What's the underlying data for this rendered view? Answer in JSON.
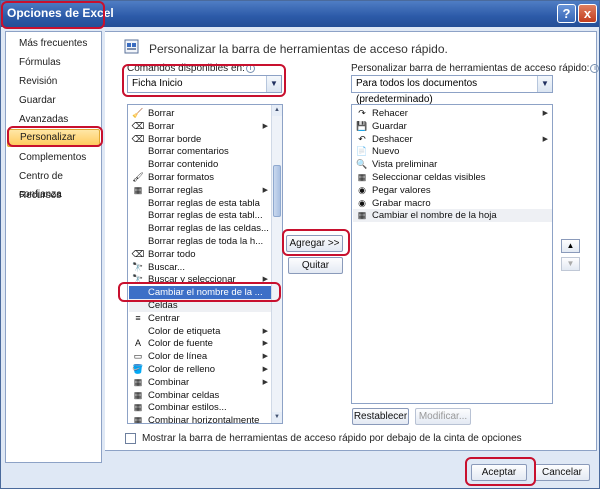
{
  "window": {
    "title": "Opciones de Excel",
    "help_glyph": "?",
    "close_glyph": "x"
  },
  "sidebar": {
    "items": [
      {
        "label": "Más frecuentes"
      },
      {
        "label": "Fórmulas"
      },
      {
        "label": "Revisión"
      },
      {
        "label": "Guardar"
      },
      {
        "label": "Avanzadas"
      },
      {
        "label": "Personalizar",
        "selected": true
      },
      {
        "label": "Complementos"
      },
      {
        "label": "Centro de confianza"
      },
      {
        "label": "Recursos"
      }
    ]
  },
  "header": {
    "title": "Personalizar la barra de herramientas de acceso rápido."
  },
  "commands": {
    "label": "Comandos disponibles en:",
    "combo_value": "Ficha Inicio",
    "items": [
      {
        "label": "Borrar",
        "icon": "🧹"
      },
      {
        "label": "Borrar",
        "icon": "⌫",
        "submenu": true
      },
      {
        "label": "Borrar borde",
        "icon": "⌫"
      },
      {
        "label": "Borrar comentarios",
        "icon": ""
      },
      {
        "label": "Borrar contenido",
        "icon": ""
      },
      {
        "label": "Borrar formatos",
        "icon": "🖌"
      },
      {
        "label": "Borrar reglas",
        "icon": "▦",
        "submenu": true
      },
      {
        "label": "Borrar reglas de esta tabla",
        "icon": ""
      },
      {
        "label": "Borrar reglas de esta tabl...",
        "icon": ""
      },
      {
        "label": "Borrar reglas de las celdas...",
        "icon": ""
      },
      {
        "label": "Borrar reglas de toda la h...",
        "icon": ""
      },
      {
        "label": "Borrar todo",
        "icon": "⌫"
      },
      {
        "label": "Buscar...",
        "icon": "🔭"
      },
      {
        "label": "Buscar y seleccionar",
        "icon": "🔭",
        "submenu": true
      },
      {
        "label": "Cambiar el nombre de la ...",
        "icon": "",
        "highlighted": true
      },
      {
        "label": "Celdas",
        "icon": "",
        "faint": true
      },
      {
        "label": "Centrar",
        "icon": "≡"
      },
      {
        "label": "Color de etiqueta",
        "icon": "",
        "submenu": true
      },
      {
        "label": "Color de fuente",
        "icon": "A",
        "submenu": true
      },
      {
        "label": "Color de línea",
        "icon": "▭",
        "submenu": true
      },
      {
        "label": "Color de relleno",
        "icon": "🪣",
        "submenu": true
      },
      {
        "label": "Combinar",
        "icon": "▦",
        "submenu": true
      },
      {
        "label": "Combinar celdas",
        "icon": "▦"
      },
      {
        "label": "Combinar estilos...",
        "icon": "▦"
      },
      {
        "label": "Combinar horizontalmente",
        "icon": "▦"
      }
    ]
  },
  "toolbar_target": {
    "label": "Personalizar barra de herramientas de acceso rápido:",
    "combo_value": "Para todos los documentos (predeterminado)",
    "items": [
      {
        "label": "Rehacer",
        "icon": "↷",
        "submenu": true
      },
      {
        "label": "Guardar",
        "icon": "💾"
      },
      {
        "label": "Deshacer",
        "icon": "↶",
        "submenu": true
      },
      {
        "label": "Nuevo",
        "icon": "📄"
      },
      {
        "label": "Vista preliminar",
        "icon": "🔍"
      },
      {
        "label": "Seleccionar celdas visibles",
        "icon": "▦"
      },
      {
        "label": "Pegar valores",
        "icon": "◉"
      },
      {
        "label": "Grabar macro",
        "icon": "◉"
      },
      {
        "label": "Cambiar el nombre de la hoja",
        "icon": "▦",
        "selected": true
      }
    ]
  },
  "buttons": {
    "add": "Agregar >>",
    "remove": "Quitar",
    "reset": "Restablecer",
    "modify": "Modificar...",
    "move_up": "▲",
    "move_down": "▼",
    "accept": "Aceptar",
    "cancel": "Cancelar"
  },
  "checkbox": {
    "label": "Mostrar la barra de herramientas de acceso rápido por debajo de la cinta de opciones",
    "checked": false
  },
  "colors": {
    "highlight_red": "#c8102e",
    "selection_blue": "#3c6fc7",
    "title_blue": "#2c5aa8"
  }
}
